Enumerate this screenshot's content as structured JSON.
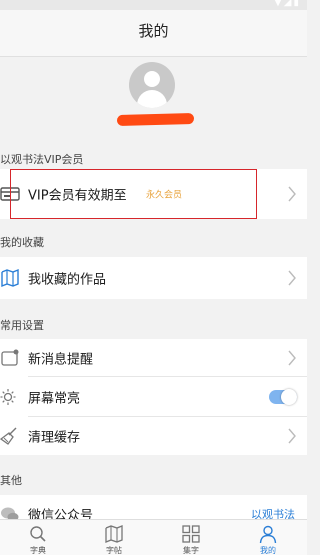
{
  "header": {
    "title": "我的"
  },
  "sections": {
    "vip": "以观书法VIP会员",
    "favorites": "我的收藏",
    "settings": "常用设置",
    "other": "其他"
  },
  "vip_row": {
    "label": "VIP会员有效期至",
    "value": "永久会员"
  },
  "favorites_row": {
    "label": "我收藏的作品"
  },
  "settings_rows": [
    {
      "label": "新消息提醒",
      "icon": "message-icon"
    },
    {
      "label": "屏幕常亮",
      "icon": "sun-icon",
      "toggle_on": true
    },
    {
      "label": "清理缓存",
      "icon": "broom-icon"
    }
  ],
  "other_rows": [
    {
      "label": "微信公众号",
      "value": "以观书法",
      "icon": "wechat-icon"
    }
  ],
  "tabbar": {
    "items": [
      {
        "label": "字典",
        "icon": "search-icon"
      },
      {
        "label": "字帖",
        "icon": "book-icon"
      },
      {
        "label": "集字",
        "icon": "grid-icon"
      },
      {
        "label": "我的",
        "icon": "user-icon",
        "active": true
      }
    ]
  },
  "colors": {
    "accent": "#2a7ed6",
    "vip_gold": "#e8a33c",
    "highlight_red": "#d6262b",
    "redaction": "#ff4a13"
  }
}
